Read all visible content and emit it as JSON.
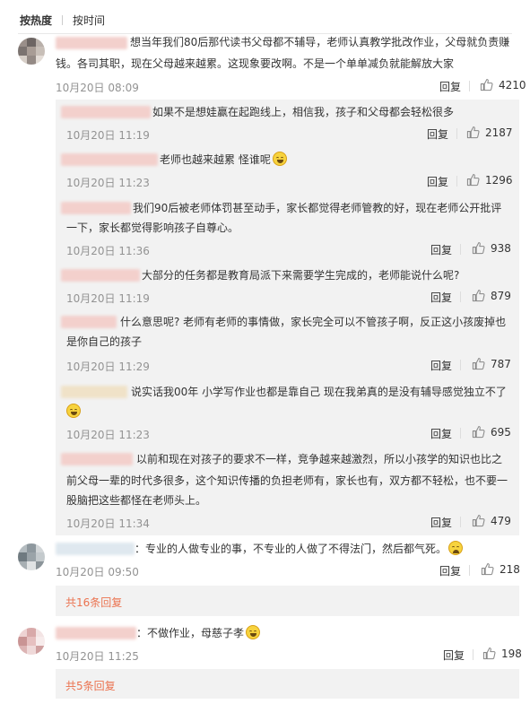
{
  "tabs": {
    "hot": "按热度",
    "time": "按时间"
  },
  "comments": [
    {
      "text": [
        "想当年我们80后那代读书父母都不辅导，老师认真教学批改作业，父母就负责赚",
        "钱。各司其职，现在父母越来越累。这现象要改啊。不是一个单单减负就能解放大家"
      ],
      "time": "10月20日 08:09",
      "likes": "4210",
      "replies": [
        {
          "text": [
            "如果不是想娃赢在起跑线上，相信我，孩子和父母都会轻松很多"
          ],
          "time": "10月20日 11:19",
          "likes": "2187"
        },
        {
          "text": [
            "老师也越来越累 怪谁呢"
          ],
          "time": "10月20日 11:23",
          "likes": "1296"
        },
        {
          "text": [
            "我们90后被老师体罚甚至动手，家长都觉得老师管教的好，现在老师公开批评",
            "一下，家长都觉得影响孩子自尊心。"
          ],
          "time": "10月20日 11:36",
          "likes": "938"
        },
        {
          "text": [
            "大部分的任务都是教育局派下来需要学生完成的，老师能说什么呢?"
          ],
          "time": "10月20日 11:19",
          "likes": "879"
        },
        {
          "text": [
            "什么意思呢? 老师有老师的事情做，家长完全可以不管孩子啊，反正这小孩废掉也",
            "是你自己的孩子"
          ],
          "time": "10月20日 11:29",
          "likes": "787"
        },
        {
          "text": [
            "说实话我00年 小学写作业也都是靠自己 现在我弟真的是没有辅导感觉独立不了"
          ],
          "time": "10月20日 11:23",
          "likes": "695"
        },
        {
          "text": [
            "以前和现在对孩子的要求不一样，竞争越来越激烈，所以小孩学的知识也比之",
            "前父母一辈的时代多很多，这个知识传播的负担老师有，家长也有，双方都不轻松，也不要一",
            "股脑把这些都怪在老师头上。"
          ],
          "time": "10月20日 11:34",
          "likes": "479"
        }
      ]
    },
    {
      "text": [
        "：专业的人做专业的事，不专业的人做了不得法门，然后都气死。"
      ],
      "time": "10月20日 09:50",
      "likes": "218",
      "more": "共16条回复"
    },
    {
      "text": [
        "：不做作业，母慈子孝"
      ],
      "time": "10月20日 11:25",
      "likes": "198",
      "more": "共5条回复"
    }
  ],
  "reply_label": "回复",
  "icons": {
    "like": "thumbs-up-icon",
    "emoji": "laughing-emoji-icon",
    "cry": "crying-emoji-icon"
  },
  "colors": {
    "more_link": "#eb7350",
    "meta": "#939393",
    "subbox": "#f2f2f2"
  }
}
